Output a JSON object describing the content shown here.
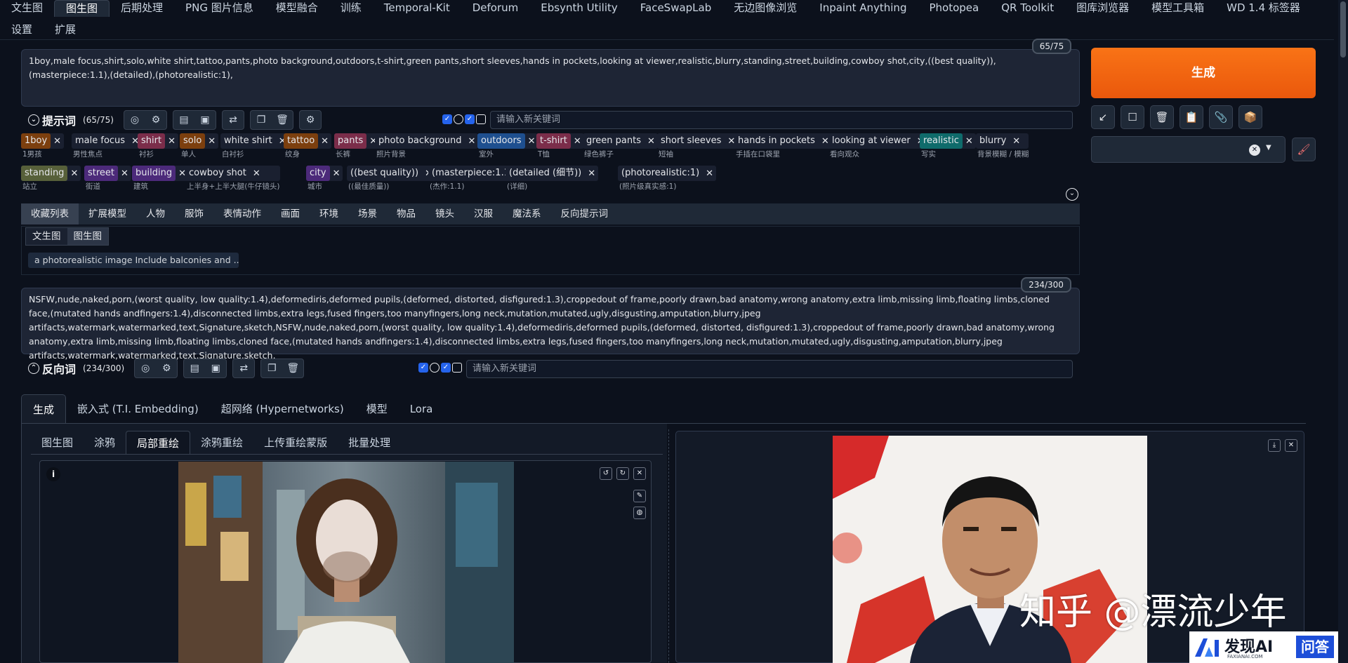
{
  "nav": {
    "row1": [
      "文生图",
      "图生图",
      "后期处理",
      "PNG 图片信息",
      "模型融合",
      "训练",
      "Temporal-Kit",
      "Deforum",
      "Ebsynth Utility",
      "FaceSwapLab",
      "无边图像浏览",
      "Inpaint Anything",
      "Photopea",
      "QR Toolkit",
      "图库浏览器",
      "模型工具箱",
      "WD 1.4 标签器"
    ],
    "row2": [
      "设置",
      "扩展"
    ]
  },
  "prompt": {
    "text": "1boy,male focus,shirt,solo,white shirt,tattoo,pants,photo background,outdoors,t-shirt,green pants,short sleeves,hands in pockets,looking at viewer,realistic,blurry,standing,street,building,cowboy shot,city,((best quality)),(masterpiece:1.1),(detailed),(photorealistic:1),",
    "counter": "65/75",
    "label": "提示词",
    "count": "(65/75)",
    "keyword_placeholder": "请输入新关键词"
  },
  "tags": [
    {
      "en": "1boy",
      "zh": "1男孩",
      "color": "#7c3f0e"
    },
    {
      "en": "male focus",
      "zh": "男性焦点",
      "color": ""
    },
    {
      "en": "shirt",
      "zh": "衬衫",
      "color": "#7b2d4a"
    },
    {
      "en": "solo",
      "zh": "单人",
      "color": "#7c3f0e"
    },
    {
      "en": "white shirt",
      "zh": "白衬衫",
      "color": ""
    },
    {
      "en": "tattoo",
      "zh": "纹身",
      "color": "#7c3f0e"
    },
    {
      "en": "pants",
      "zh": "长裤",
      "color": "#7b2d4a"
    },
    {
      "en": "photo background",
      "zh": "照片背景",
      "color": ""
    },
    {
      "en": "outdoors",
      "zh": "室外",
      "color": "#1e4f8f"
    },
    {
      "en": "t-shirt",
      "zh": "T恤",
      "color": "#7b2d4a"
    },
    {
      "en": "green pants",
      "zh": "绿色裤子",
      "color": ""
    },
    {
      "en": "short sleeves",
      "zh": "短袖",
      "color": ""
    },
    {
      "en": "hands in pockets",
      "zh": "手插在口袋里",
      "color": ""
    },
    {
      "en": "looking at viewer",
      "zh": "看向观众",
      "color": ""
    },
    {
      "en": "realistic",
      "zh": "写实",
      "color": "#0f6b6b"
    },
    {
      "en": "blurry",
      "zh": "背景模糊 / 模糊",
      "color": ""
    },
    {
      "en": "standing",
      "zh": "站立",
      "color": "#57603a"
    },
    {
      "en": "street",
      "zh": "街道",
      "color": "#4c2a7a"
    },
    {
      "en": "building",
      "zh": "建筑",
      "color": "#4c2a7a"
    },
    {
      "en": "cowboy shot",
      "zh": "上半身+上半大腿(牛仔镜头)",
      "color": ""
    },
    {
      "en": "city",
      "zh": "城市",
      "color": "#4c2a7a"
    },
    {
      "en": "((best quality))",
      "zh": "((最佳质量))",
      "color": ""
    },
    {
      "en": "(masterpiece:1.1)",
      "zh": "(杰作:1.1)",
      "color": ""
    },
    {
      "en": "(detailed (细节))",
      "zh": "(详细)",
      "color": ""
    },
    {
      "en": "(photorealistic:1)",
      "zh": "(照片级真实感:1)",
      "color": ""
    }
  ],
  "categories": [
    "收藏列表",
    "扩展模型",
    "人物",
    "服饰",
    "表情动作",
    "画面",
    "环境",
    "场景",
    "物品",
    "镜头",
    "汉服",
    "魔法系",
    "反向提示词"
  ],
  "fav_subtabs": [
    "文生图",
    "图生图"
  ],
  "fav_item": "a photorealistic image Include balconies and ...",
  "negative": {
    "text": "NSFW,nude,naked,porn,(worst quality, low quality:1.4),deformediris,deformed pupils,(deformed, distorted, disfigured:1.3),croppedout of frame,poorly drawn,bad anatomy,wrong anatomy,extra limb,missing limb,floating limbs,cloned face,(mutated hands andfingers:1.4),disconnected limbs,extra legs,fused fingers,too manyfingers,long neck,mutation,mutated,ugly,disgusting,amputation,blurry,jpeg artifacts,watermark,watermarked,text,Signature,sketch,NSFW,nude,naked,porn,(worst quality, low quality:1.4),deformediris,deformed pupils,(deformed, distorted, disfigured:1.3),croppedout of frame,poorly drawn,bad anatomy,wrong anatomy,extra limb,missing limb,floating limbs,cloned face,(mutated hands andfingers:1.4),disconnected limbs,extra legs,fused fingers,too manyfingers,long neck,mutation,mutated,ugly,disgusting,amputation,blurry,jpeg artifacts,watermark,watermarked,text,Signature,sketch,",
    "counter": "234/300",
    "label": "反向词",
    "count": "(234/300)",
    "keyword_placeholder": "请输入新关键词"
  },
  "generate_label": "生成",
  "bottom_tabs": [
    "生成",
    "嵌入式 (T.I. Embedding)",
    "超网络 (Hypernetworks)",
    "模型",
    "Lora"
  ],
  "img2img_tabs": [
    "图生图",
    "涂鸦",
    "局部重绘",
    "涂鸦重绘",
    "上传重绘蒙版",
    "批量处理"
  ],
  "info_label": "i",
  "watermark": "知乎 @漂流少年",
  "logo": {
    "name": "发现AI",
    "qa": "问答",
    "sub": "FAXIANAI.COM"
  }
}
